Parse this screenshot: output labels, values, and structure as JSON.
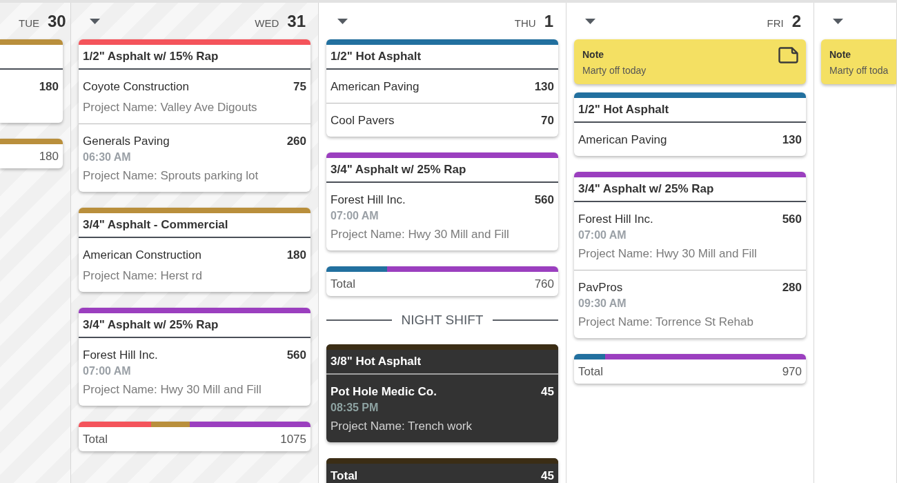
{
  "days": [
    {
      "kind": "clipped_left",
      "weekday": "TUE",
      "date": "30",
      "past": true,
      "groups": [
        {
          "color": "#b98f3c",
          "rows": [
            {
              "quantity": "180"
            }
          ]
        }
      ],
      "total": {
        "value": "180"
      }
    },
    {
      "kind": "full",
      "weekday": "WED",
      "date": "31",
      "past": true,
      "groups": [
        {
          "color": "#f4545b",
          "title": "1/2\" Asphalt w/ 15% Rap",
          "rows": [
            {
              "customer": "Coyote Construction",
              "quantity": "75",
              "project": "Project Name: Valley Ave Digouts"
            },
            {
              "customer": "Generals Paving",
              "quantity": "260",
              "time": "06:30 AM",
              "project": "Project Name: Sprouts parking lot"
            }
          ]
        },
        {
          "color": "#b98f3c",
          "title": "3/4\" Asphalt - Commercial",
          "rows": [
            {
              "customer": "American Construction",
              "quantity": "180",
              "project": "Project Name: Herst rd"
            }
          ]
        },
        {
          "color": "#9b3fbf",
          "title": "3/4\" Asphalt w/ 25% Rap",
          "rows": [
            {
              "customer": "Forest Hill Inc.",
              "quantity": "560",
              "time": "07:00 AM",
              "project": "Project Name: Hwy 30 Mill and Fill"
            }
          ]
        }
      ],
      "total": {
        "label": "Total",
        "value": "1075"
      }
    },
    {
      "kind": "full",
      "weekday": "THU",
      "date": "1",
      "past": false,
      "groups": [
        {
          "color": "#22709f",
          "title": "1/2\" Hot Asphalt",
          "rows": [
            {
              "customer": "American Paving",
              "quantity": "130"
            },
            {
              "customer": "Cool Pavers",
              "quantity": "70"
            }
          ]
        },
        {
          "color": "#9b3fbf",
          "title": "3/4\" Asphalt w/ 25% Rap",
          "rows": [
            {
              "customer": "Forest Hill Inc.",
              "quantity": "560",
              "time": "07:00 AM",
              "project": "Project Name: Hwy 30 Mill and Fill"
            }
          ]
        }
      ],
      "total": {
        "label": "Total",
        "value": "760"
      },
      "night_shift": {
        "label": "NIGHT SHIFT",
        "groups": [
          {
            "color": "#3b2d15",
            "title": "3/8\" Hot Asphalt",
            "rows": [
              {
                "customer": "Pot Hole Medic Co.",
                "quantity": "45",
                "time": "08:35 PM",
                "project": "Project Name: Trench work"
              }
            ]
          }
        ],
        "total": {
          "label": "Total",
          "value": "45"
        }
      }
    },
    {
      "kind": "full",
      "weekday": "FRI",
      "date": "2",
      "past": false,
      "note": {
        "title": "Note",
        "text": "Marty off today"
      },
      "groups": [
        {
          "color": "#22709f",
          "title": "1/2\" Hot Asphalt",
          "rows": [
            {
              "customer": "American Paving",
              "quantity": "130"
            }
          ]
        },
        {
          "color": "#9b3fbf",
          "title": "3/4\" Asphalt w/ 25% Rap",
          "rows": [
            {
              "customer": "Forest Hill Inc.",
              "quantity": "560",
              "time": "07:00 AM",
              "project": "Project Name: Hwy 30 Mill and Fill"
            },
            {
              "customer": "PavPros",
              "quantity": "280",
              "time": "09:30 AM",
              "project": "Project Name: Torrence St Rehab"
            }
          ]
        }
      ],
      "total": {
        "label": "Total",
        "value": "970"
      }
    },
    {
      "kind": "clipped_right",
      "past": false,
      "note": {
        "title": "Note",
        "text": "Marty off toda"
      }
    }
  ]
}
